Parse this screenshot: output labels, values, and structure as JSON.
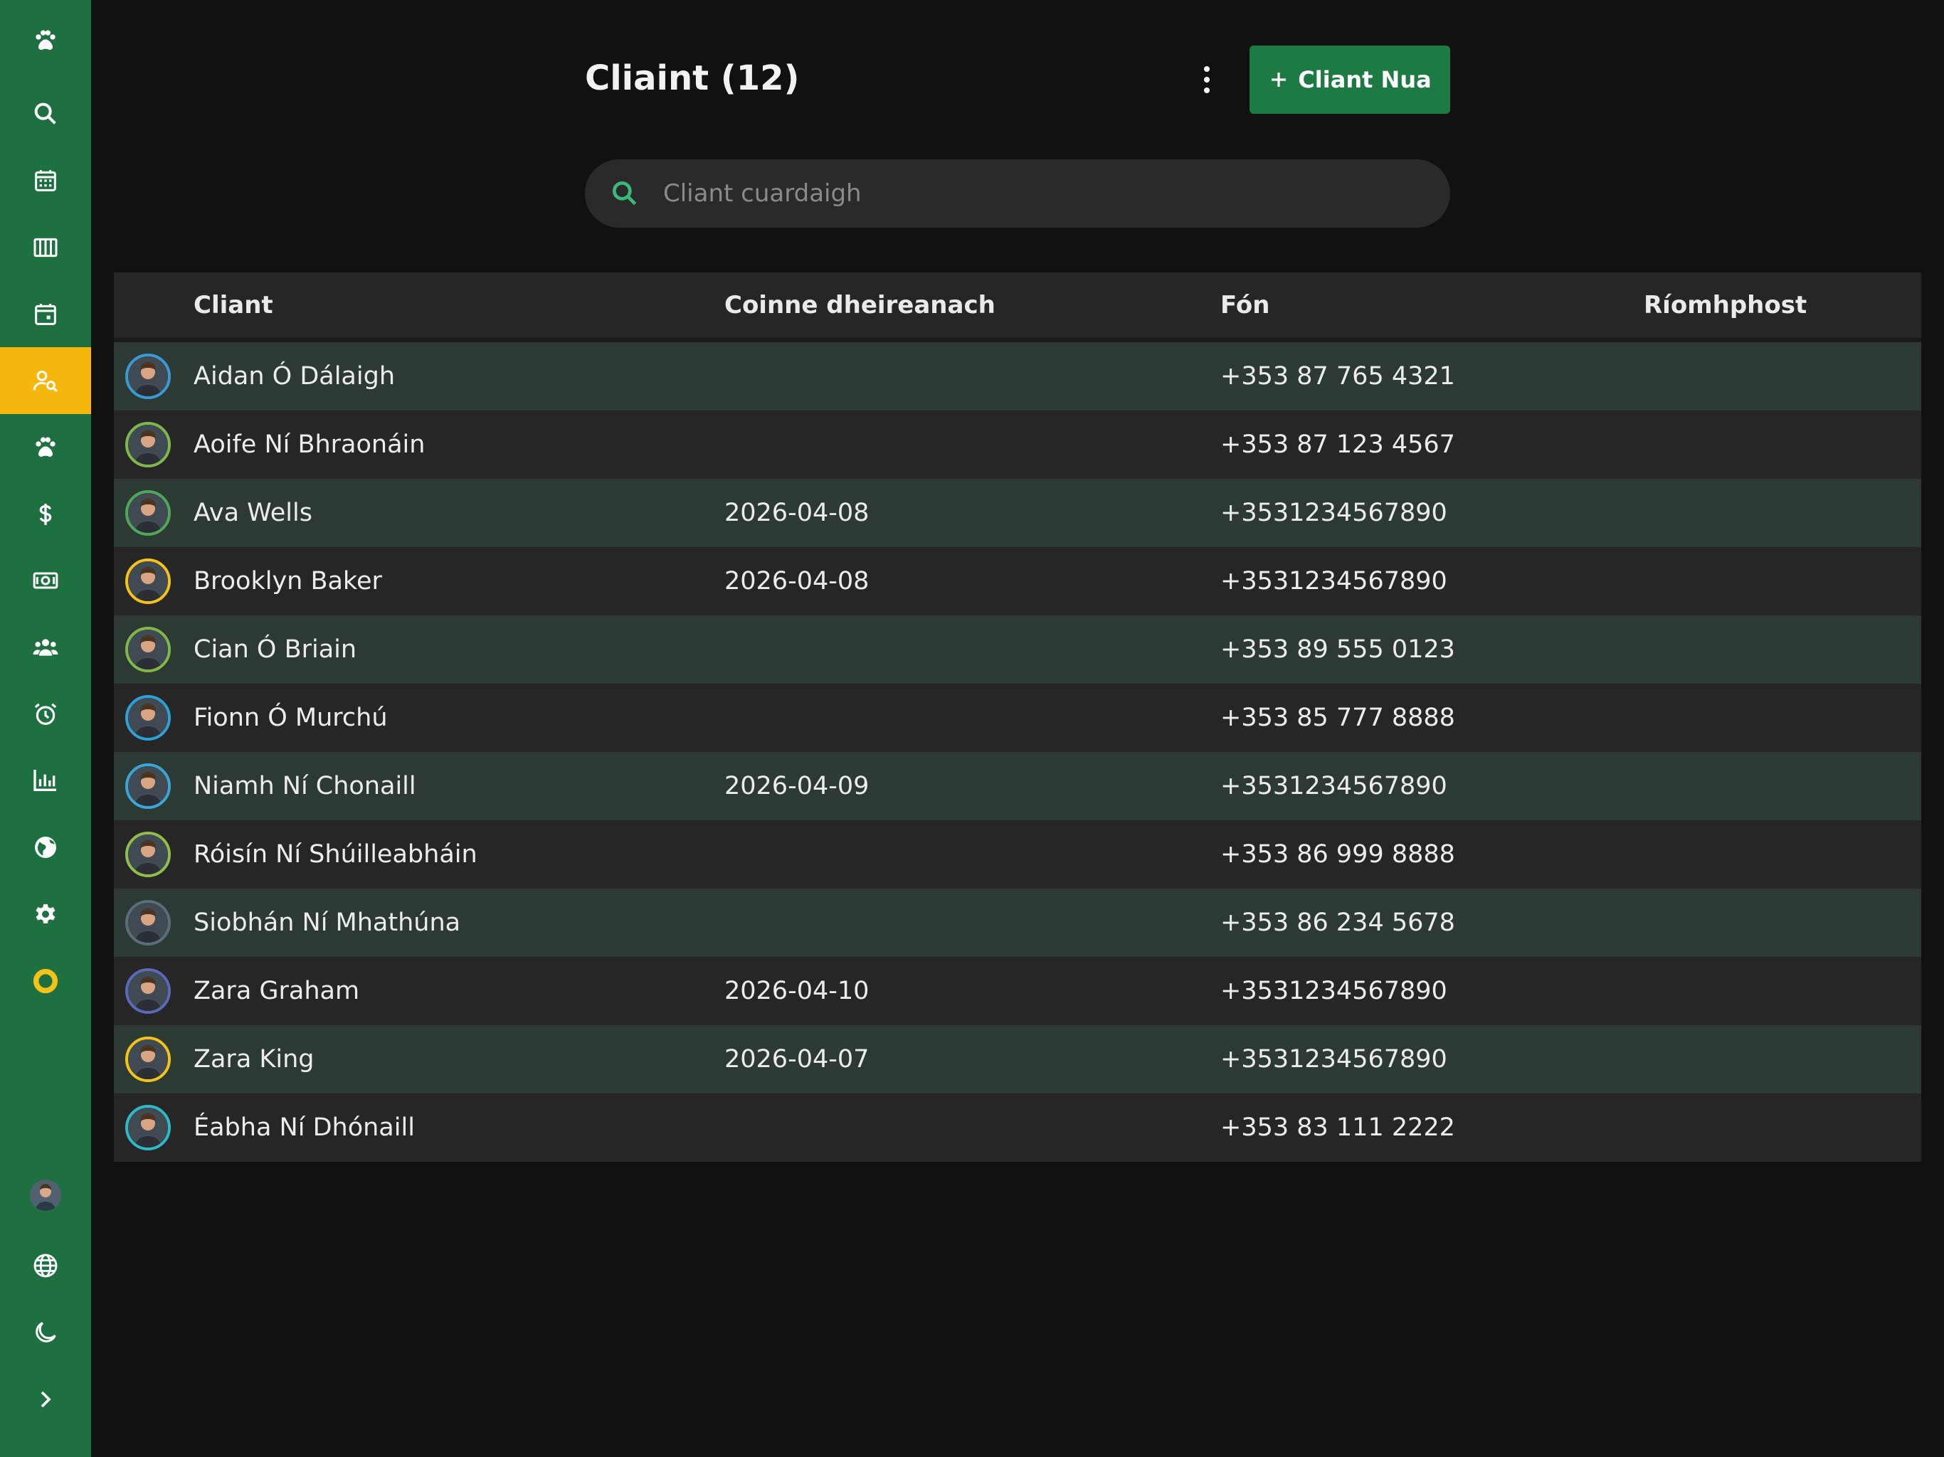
{
  "page": {
    "title": "Cliaint (12)",
    "new_button_label": "Cliant Nua",
    "search_placeholder": "Cliant cuardaigh"
  },
  "sidebar": {
    "items": [
      {
        "icon": "paw-icon"
      },
      {
        "icon": "search-icon"
      },
      {
        "icon": "calendar-grid-icon"
      },
      {
        "icon": "columns-icon"
      },
      {
        "icon": "calendar-day-icon"
      },
      {
        "icon": "client-search-icon",
        "active": true
      },
      {
        "icon": "paw-icon"
      },
      {
        "icon": "dollar-icon"
      },
      {
        "icon": "cash-icon"
      },
      {
        "icon": "users-icon"
      },
      {
        "icon": "alarm-clock-icon"
      },
      {
        "icon": "bar-chart-icon"
      },
      {
        "icon": "globe-icon"
      },
      {
        "icon": "gear-icon"
      },
      {
        "icon": "ring-logo-icon"
      }
    ],
    "bottom": [
      {
        "icon": "user-avatar"
      },
      {
        "icon": "language-globe-icon"
      },
      {
        "icon": "moon-icon"
      },
      {
        "icon": "chevron-right-icon"
      }
    ],
    "active_color": "#f5b60e",
    "background_color": "#1e7040"
  },
  "table": {
    "headers": {
      "client": "Cliant",
      "last_appointment": "Coinne dheireanach",
      "phone": "Fón",
      "email": "Ríomhphost"
    },
    "rows": [
      {
        "name": "Aidan Ó Dálaigh",
        "date": "",
        "phone": "+353 87 765 4321",
        "email": "",
        "ring": "#3a9ad8"
      },
      {
        "name": "Aoife Ní Bhraonáin",
        "date": "",
        "phone": "+353 87 123 4567",
        "email": "",
        "ring": "#7fb84a"
      },
      {
        "name": "Ava Wells",
        "date": "2026-04-08",
        "phone": "+3531234567890",
        "email": "",
        "ring": "#4fa85a"
      },
      {
        "name": "Brooklyn Baker",
        "date": "2026-04-08",
        "phone": "+3531234567890",
        "email": "",
        "ring": "#f5c21a"
      },
      {
        "name": "Cian Ó Briain",
        "date": "",
        "phone": "+353 89 555 0123",
        "email": "",
        "ring": "#7fb84a"
      },
      {
        "name": "Fionn Ó Murchú",
        "date": "",
        "phone": "+353 85 777 8888",
        "email": "",
        "ring": "#2f9fd8"
      },
      {
        "name": "Niamh Ní Chonaill",
        "date": "2026-04-09",
        "phone": "+3531234567890",
        "email": "",
        "ring": "#3aa6d8"
      },
      {
        "name": "Róisín Ní Shúilleabháin",
        "date": "",
        "phone": "+353 86 999 8888",
        "email": "",
        "ring": "#8fbf4a"
      },
      {
        "name": "Siobhán Ní Mhathúna",
        "date": "",
        "phone": "+353 86 234 5678",
        "email": "",
        "ring": "#5a6e7a"
      },
      {
        "name": "Zara Graham",
        "date": "2026-04-10",
        "phone": "+3531234567890",
        "email": "",
        "ring": "#5a6ab8"
      },
      {
        "name": "Zara King",
        "date": "2026-04-07",
        "phone": "+3531234567890",
        "email": "",
        "ring": "#f5c21a"
      },
      {
        "name": "Éabha Ní Dhónaill",
        "date": "",
        "phone": "+353 83 111 2222",
        "email": "",
        "ring": "#2fb8c8"
      }
    ]
  },
  "colors": {
    "primary_button": "#1e7a43",
    "search_icon": "#3cb878",
    "row_alt": "#2d3a33"
  }
}
